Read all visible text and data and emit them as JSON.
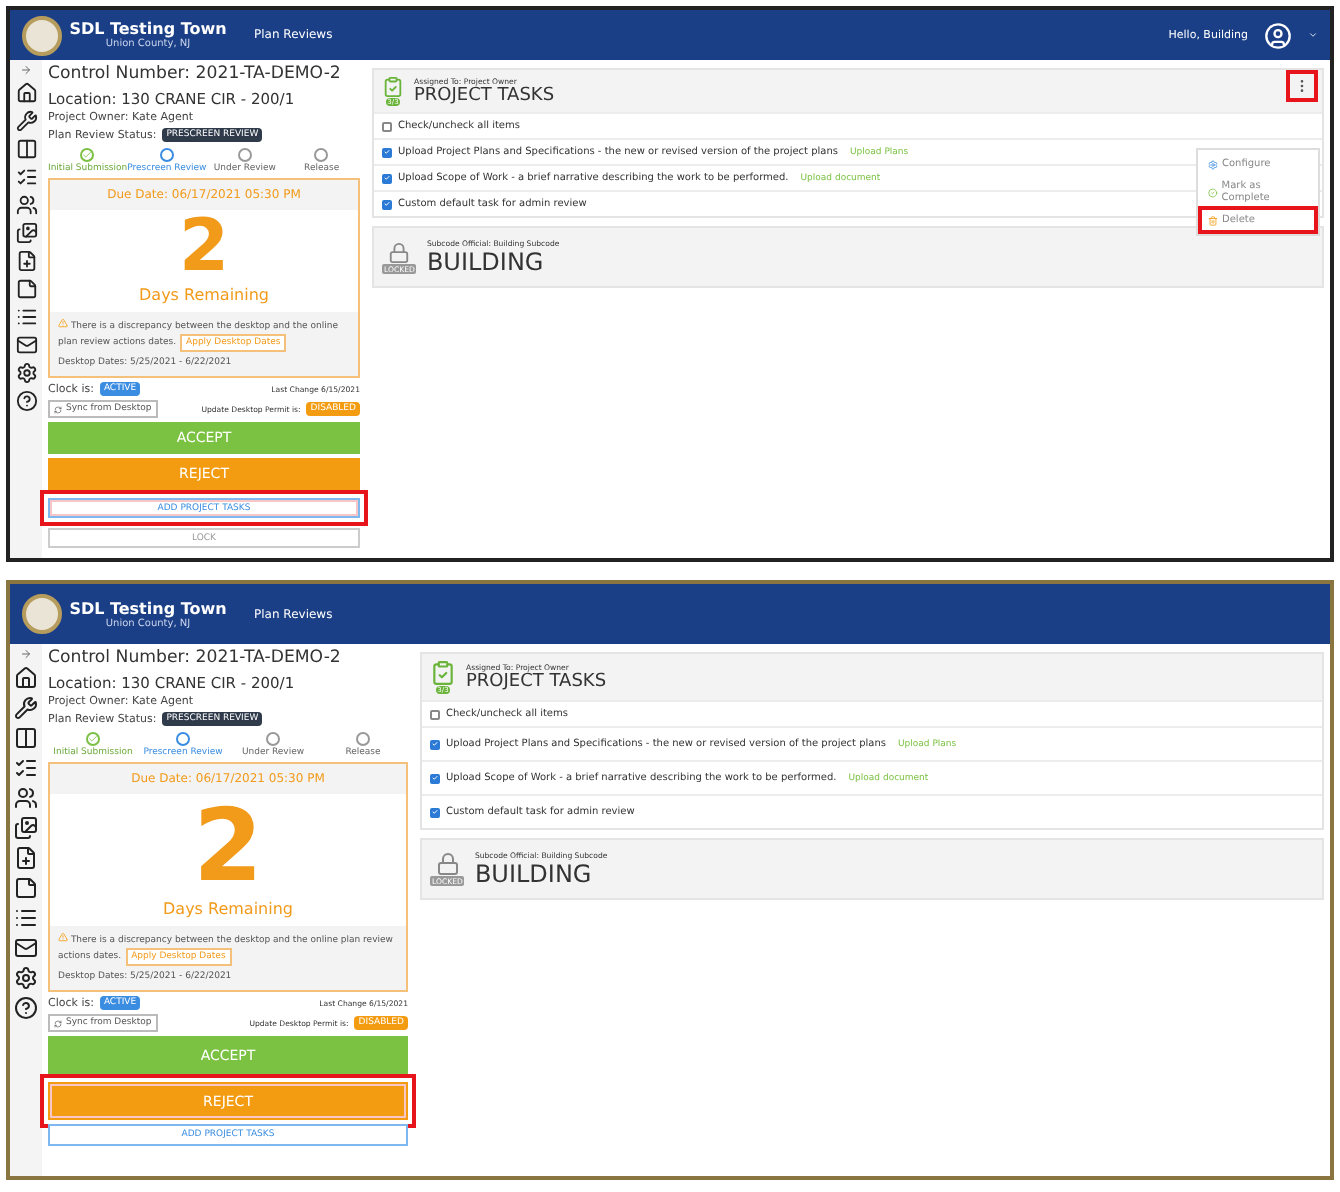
{
  "screens": [
    {
      "header": {
        "title": "SDL Testing Town",
        "subtitle": "Union County, NJ",
        "nav": "Plan Reviews",
        "greeting": "Hello, Building"
      },
      "project": {
        "control_number": "Control Number: 2021-TA-DEMO-2",
        "location": "Location: 130 CRANE CIR - 200/1",
        "owner": "Project Owner: Kate Agent",
        "status_label": "Plan Review Status:",
        "status": "PRESCREEN REVIEW"
      },
      "steps": [
        {
          "label": "Initial Submission",
          "kind": "done"
        },
        {
          "label": "Prescreen Review",
          "kind": "current"
        },
        {
          "label": "Under Review",
          "kind": "todo"
        },
        {
          "label": "Release",
          "kind": "todo"
        }
      ],
      "due": {
        "date": "Due Date: 06/17/2021 05:30 PM",
        "count": "2",
        "caption": "Days Remaining",
        "warning": "There is a discrepancy between the desktop and the online plan review actions dates.",
        "apply_button": "Apply Desktop Dates",
        "desktop_dates": "Desktop Dates: 5/25/2021 - 6/22/2021"
      },
      "clock": {
        "label": "Clock is:",
        "status": "ACTIVE",
        "last_change": "Last Change 6/15/2021",
        "sync_button": "Sync from Desktop",
        "permit_label": "Update Desktop Permit is:",
        "permit_status": "DISABLED"
      },
      "actions": [
        {
          "kind": "accept",
          "label": "ACCEPT",
          "highlighted": false
        },
        {
          "kind": "reject",
          "label": "REJECT",
          "highlighted": false
        },
        {
          "kind": "outline",
          "label": "ADD PROJECT TASKS",
          "highlighted": true
        },
        {
          "kind": "plain",
          "label": "LOCK",
          "highlighted": false
        }
      ],
      "tasks": {
        "assigned": "Assigned To: Project Owner",
        "title": "PROJECT TASKS",
        "badge": "3/3",
        "check_all": {
          "label": "Check/uncheck all items",
          "checked": false
        },
        "items": [
          {
            "label": "Upload Project Plans and Specifications - the new or revised version of the project plans",
            "link": "Upload Plans",
            "checked": true
          },
          {
            "label": "Upload Scope of Work - a brief narrative describing the work to be performed.",
            "link": "Upload document",
            "checked": true
          },
          {
            "label": "Custom default task for admin review",
            "checked": true
          }
        ]
      },
      "menu": {
        "trigger_highlighted": true,
        "items": [
          {
            "kind": "configure",
            "label": "Configure",
            "highlighted": false
          },
          {
            "kind": "complete",
            "label": "Mark as Complete",
            "highlighted": false
          },
          {
            "kind": "delete",
            "label": "Delete",
            "highlighted": true
          }
        ]
      },
      "subcode": {
        "official": "Subcode Official: Building Subcode",
        "badge": "LOCKED",
        "title": "BUILDING"
      }
    },
    {
      "header": {
        "title": "SDL Testing Town",
        "subtitle": "Union County, NJ",
        "nav": "Plan Reviews"
      },
      "project": {
        "control_number": "Control Number: 2021-TA-DEMO-2",
        "location": "Location: 130 CRANE CIR - 200/1",
        "owner": "Project Owner: Kate Agent",
        "status_label": "Plan Review Status:",
        "status": "PRESCREEN REVIEW"
      },
      "steps": [
        {
          "label": "Initial Submission",
          "kind": "done"
        },
        {
          "label": "Prescreen Review",
          "kind": "current"
        },
        {
          "label": "Under Review",
          "kind": "todo"
        },
        {
          "label": "Release",
          "kind": "todo"
        }
      ],
      "due": {
        "date": "Due Date: 06/17/2021 05:30 PM",
        "count": "2",
        "caption": "Days Remaining",
        "warning": "There is a discrepancy between the desktop and the online plan review actions dates.",
        "apply_button": "Apply Desktop Dates",
        "desktop_dates": "Desktop Dates: 5/25/2021 - 6/22/2021"
      },
      "clock": {
        "label": "Clock is:",
        "status": "ACTIVE",
        "last_change": "Last Change 6/15/2021",
        "sync_button": "Sync from Desktop",
        "permit_label": "Update Desktop Permit is:",
        "permit_status": "DISABLED"
      },
      "actions": [
        {
          "kind": "accept",
          "label": "ACCEPT",
          "highlighted": false
        },
        {
          "kind": "reject",
          "label": "REJECT",
          "highlighted": true
        },
        {
          "kind": "outline",
          "label": "ADD PROJECT TASKS",
          "highlighted": false
        }
      ],
      "tasks": {
        "assigned": "Assigned To: Project Owner",
        "title": "PROJECT TASKS",
        "badge": "3/3",
        "check_all": {
          "label": "Check/uncheck all items",
          "checked": false
        },
        "items": [
          {
            "label": "Upload Project Plans and Specifications - the new or revised version of the project plans",
            "link": "Upload Plans",
            "checked": true
          },
          {
            "label": "Upload Scope of Work - a brief narrative describing the work to be performed.",
            "link": "Upload document",
            "checked": true
          },
          {
            "label": "Custom default task for admin review",
            "checked": true
          }
        ]
      },
      "subcode": {
        "official": "Subcode Official: Building Subcode",
        "badge": "LOCKED",
        "title": "BUILDING"
      }
    }
  ]
}
